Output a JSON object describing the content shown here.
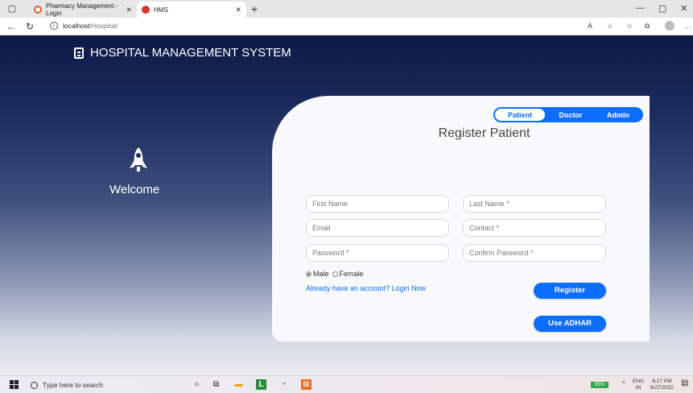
{
  "browser": {
    "tabs": [
      {
        "label": "Pharmacy Management - Login"
      },
      {
        "label": "HMS"
      }
    ],
    "url_host": "localhost",
    "url_path": "/Hospital/"
  },
  "app": {
    "brand": "HOSPITAL MANAGEMENT SYSTEM",
    "welcome": "Welcome"
  },
  "form": {
    "tabs": [
      "Patient",
      "Doctor",
      "Admin"
    ],
    "title": "Register Patient",
    "placeholders": {
      "first_name": "First Name",
      "last_name": "Last Name *",
      "email": "Email",
      "contact": "Contact *",
      "password": "Password *",
      "confirm_password": "Confirm Password *"
    },
    "gender": {
      "male": "Male",
      "female": "Female",
      "selected": "Male"
    },
    "login_link": "Already have an account? Login Now",
    "register_button": "Register",
    "adhar_button": "Use ADHAR"
  },
  "taskbar": {
    "search_placeholder": "Type here to search",
    "battery": "95%",
    "lang": "ENG",
    "region": "IN",
    "time": "6:17 PM",
    "date": "6/27/2022"
  }
}
